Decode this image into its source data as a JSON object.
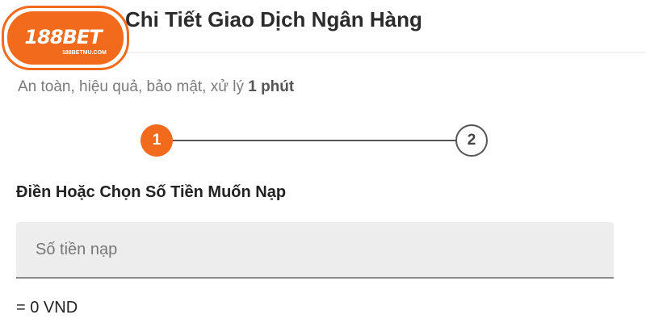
{
  "header": {
    "title": "Chi Tiết Giao Dịch Ngân Hàng",
    "logo": {
      "text": "188BET",
      "sub": "188BETMU.COM",
      "color": "#f26a1b"
    }
  },
  "subtitle": {
    "text": "An toàn, hiệu quả, bảo mật, xử lý ",
    "bold": "1 phút"
  },
  "stepper": {
    "steps": [
      "1",
      "2"
    ],
    "active_color": "#f26a1b"
  },
  "form": {
    "label": "Điền Hoặc Chọn Số Tiền Muốn Nạp",
    "amount_placeholder": "Số tiền nạp",
    "amount_value": "",
    "converted": "= 0 VND"
  }
}
